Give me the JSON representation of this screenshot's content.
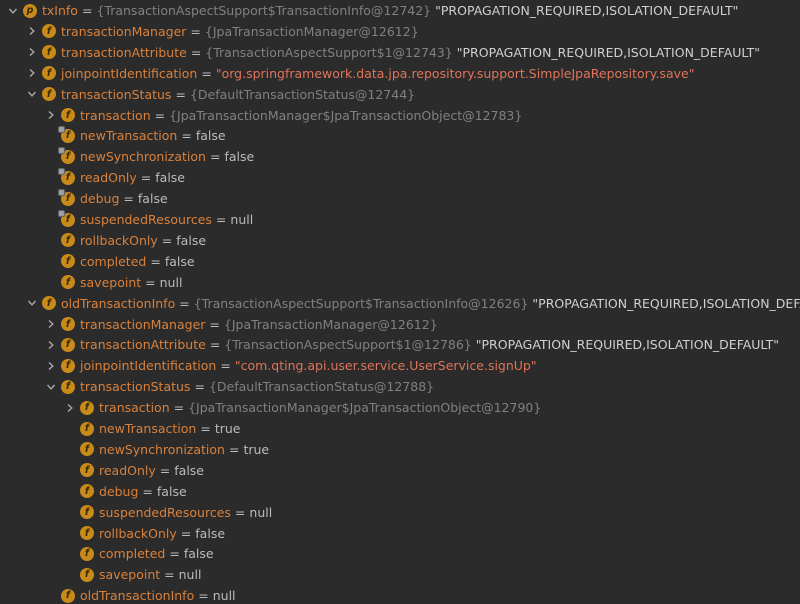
{
  "rows": [
    {
      "name": "txInfo",
      "badge": "p",
      "locked": false,
      "expanded": true,
      "hasArrow": true,
      "typeref": "{TransactionAspectSupport$TransactionInfo@12742}",
      "extra": "\"PROPAGATION_REQUIRED,ISOLATION_DEFAULT\"",
      "value": "",
      "valueKind": "ref"
    },
    {
      "name": "transactionManager",
      "badge": "f",
      "locked": false,
      "expanded": false,
      "hasArrow": true,
      "typeref": "{JpaTransactionManager@12612}",
      "extra": "",
      "value": "",
      "valueKind": "ref"
    },
    {
      "name": "transactionAttribute",
      "badge": "f",
      "locked": false,
      "expanded": false,
      "hasArrow": true,
      "typeref": "{TransactionAspectSupport$1@12743}",
      "extra": "\"PROPAGATION_REQUIRED,ISOLATION_DEFAULT\"",
      "value": "",
      "valueKind": "ref"
    },
    {
      "name": "joinpointIdentification",
      "badge": "f",
      "locked": false,
      "expanded": false,
      "hasArrow": true,
      "typeref": "",
      "extra": "",
      "value": "\"org.springframework.data.jpa.repository.support.SimpleJpaRepository.save\"",
      "valueKind": "string"
    },
    {
      "name": "transactionStatus",
      "badge": "f",
      "locked": false,
      "expanded": true,
      "hasArrow": true,
      "typeref": "{DefaultTransactionStatus@12744}",
      "extra": "",
      "value": "",
      "valueKind": "ref"
    },
    {
      "name": "transaction",
      "badge": "f",
      "locked": false,
      "expanded": false,
      "hasArrow": true,
      "typeref": "{JpaTransactionManager$JpaTransactionObject@12783}",
      "extra": "",
      "value": "",
      "valueKind": "ref"
    },
    {
      "name": "newTransaction",
      "badge": "f",
      "locked": true,
      "expanded": false,
      "hasArrow": false,
      "typeref": "",
      "extra": "",
      "value": "false",
      "valueKind": "plain"
    },
    {
      "name": "newSynchronization",
      "badge": "f",
      "locked": true,
      "expanded": false,
      "hasArrow": false,
      "typeref": "",
      "extra": "",
      "value": "false",
      "valueKind": "plain"
    },
    {
      "name": "readOnly",
      "badge": "f",
      "locked": true,
      "expanded": false,
      "hasArrow": false,
      "typeref": "",
      "extra": "",
      "value": "false",
      "valueKind": "plain"
    },
    {
      "name": "debug",
      "badge": "f",
      "locked": true,
      "expanded": false,
      "hasArrow": false,
      "typeref": "",
      "extra": "",
      "value": "false",
      "valueKind": "plain"
    },
    {
      "name": "suspendedResources",
      "badge": "f",
      "locked": true,
      "expanded": false,
      "hasArrow": false,
      "typeref": "",
      "extra": "",
      "value": "null",
      "valueKind": "plain"
    },
    {
      "name": "rollbackOnly",
      "badge": "f",
      "locked": false,
      "expanded": false,
      "hasArrow": false,
      "typeref": "",
      "extra": "",
      "value": "false",
      "valueKind": "plain"
    },
    {
      "name": "completed",
      "badge": "f",
      "locked": false,
      "expanded": false,
      "hasArrow": false,
      "typeref": "",
      "extra": "",
      "value": "false",
      "valueKind": "plain"
    },
    {
      "name": "savepoint",
      "badge": "f",
      "locked": false,
      "expanded": false,
      "hasArrow": false,
      "typeref": "",
      "extra": "",
      "value": "null",
      "valueKind": "plain"
    },
    {
      "name": "oldTransactionInfo",
      "badge": "f",
      "locked": false,
      "expanded": true,
      "hasArrow": true,
      "typeref": "{TransactionAspectSupport$TransactionInfo@12626}",
      "extra": "\"PROPAGATION_REQUIRED,ISOLATION_DEFAULT\"",
      "value": "",
      "valueKind": "ref"
    },
    {
      "name": "transactionManager",
      "badge": "f",
      "locked": false,
      "expanded": false,
      "hasArrow": true,
      "typeref": "{JpaTransactionManager@12612}",
      "extra": "",
      "value": "",
      "valueKind": "ref"
    },
    {
      "name": "transactionAttribute",
      "badge": "f",
      "locked": false,
      "expanded": false,
      "hasArrow": true,
      "typeref": "{TransactionAspectSupport$1@12786}",
      "extra": "\"PROPAGATION_REQUIRED,ISOLATION_DEFAULT\"",
      "value": "",
      "valueKind": "ref"
    },
    {
      "name": "joinpointIdentification",
      "badge": "f",
      "locked": false,
      "expanded": false,
      "hasArrow": true,
      "typeref": "",
      "extra": "",
      "value": "\"com.qting.api.user.service.UserService.signUp\"",
      "valueKind": "string"
    },
    {
      "name": "transactionStatus",
      "badge": "f",
      "locked": false,
      "expanded": true,
      "hasArrow": true,
      "typeref": "{DefaultTransactionStatus@12788}",
      "extra": "",
      "value": "",
      "valueKind": "ref"
    },
    {
      "name": "transaction",
      "badge": "f",
      "locked": false,
      "expanded": false,
      "hasArrow": true,
      "typeref": "{JpaTransactionManager$JpaTransactionObject@12790}",
      "extra": "",
      "value": "",
      "valueKind": "ref"
    },
    {
      "name": "newTransaction",
      "badge": "f",
      "locked": false,
      "expanded": false,
      "hasArrow": false,
      "typeref": "",
      "extra": "",
      "value": "true",
      "valueKind": "plain"
    },
    {
      "name": "newSynchronization",
      "badge": "f",
      "locked": false,
      "expanded": false,
      "hasArrow": false,
      "typeref": "",
      "extra": "",
      "value": "true",
      "valueKind": "plain"
    },
    {
      "name": "readOnly",
      "badge": "f",
      "locked": false,
      "expanded": false,
      "hasArrow": false,
      "typeref": "",
      "extra": "",
      "value": "false",
      "valueKind": "plain"
    },
    {
      "name": "debug",
      "badge": "f",
      "locked": false,
      "expanded": false,
      "hasArrow": false,
      "typeref": "",
      "extra": "",
      "value": "false",
      "valueKind": "plain"
    },
    {
      "name": "suspendedResources",
      "badge": "f",
      "locked": false,
      "expanded": false,
      "hasArrow": false,
      "typeref": "",
      "extra": "",
      "value": "null",
      "valueKind": "plain"
    },
    {
      "name": "rollbackOnly",
      "badge": "f",
      "locked": false,
      "expanded": false,
      "hasArrow": false,
      "typeref": "",
      "extra": "",
      "value": "false",
      "valueKind": "plain"
    },
    {
      "name": "completed",
      "badge": "f",
      "locked": false,
      "expanded": false,
      "hasArrow": false,
      "typeref": "",
      "extra": "",
      "value": "false",
      "valueKind": "plain"
    },
    {
      "name": "savepoint",
      "badge": "f",
      "locked": false,
      "expanded": false,
      "hasArrow": false,
      "typeref": "",
      "extra": "",
      "value": "null",
      "valueKind": "plain"
    },
    {
      "name": "oldTransactionInfo",
      "badge": "f",
      "locked": false,
      "expanded": false,
      "hasArrow": false,
      "typeref": "",
      "extra": "",
      "value": "null",
      "valueKind": "plain"
    }
  ],
  "colors": {
    "background": "#2b2b2b",
    "fieldName": "#d9813b",
    "typeRef": "#808080",
    "stringValue": "#e0735a",
    "badge": "#c88a1a"
  },
  "icons": {
    "expanded": "chevron-down-icon",
    "collapsed": "chevron-right-icon",
    "field": "field-icon",
    "property": "property-icon",
    "lock": "lock-overlay-icon"
  }
}
